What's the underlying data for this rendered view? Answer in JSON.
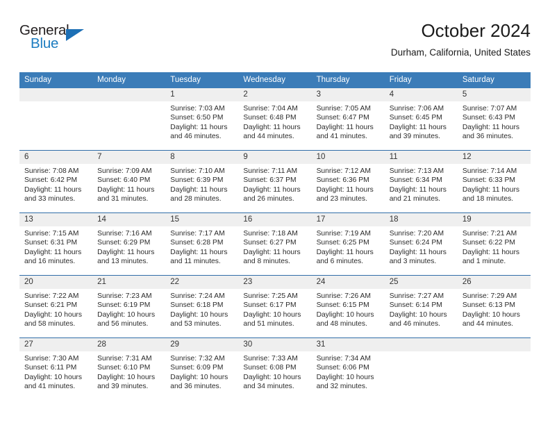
{
  "logo": {
    "line1": "General",
    "line2": "Blue",
    "triangle_icon": "triangle-icon",
    "color_dark": "#231f20",
    "color_blue": "#1c7cc0"
  },
  "header": {
    "title": "October 2024",
    "location": "Durham, California, United States"
  },
  "theme": {
    "header_blue": "#3b7cb8",
    "row_divider": "#2f6da8",
    "daynum_band": "#efefef"
  },
  "weekdays": [
    "Sunday",
    "Monday",
    "Tuesday",
    "Wednesday",
    "Thursday",
    "Friday",
    "Saturday"
  ],
  "weeks": [
    [
      {
        "day": "",
        "sunrise": "",
        "sunset": "",
        "daylight_1": "",
        "daylight_2": ""
      },
      {
        "day": "",
        "sunrise": "",
        "sunset": "",
        "daylight_1": "",
        "daylight_2": ""
      },
      {
        "day": "1",
        "sunrise": "Sunrise: 7:03 AM",
        "sunset": "Sunset: 6:50 PM",
        "daylight_1": "Daylight: 11 hours",
        "daylight_2": "and 46 minutes."
      },
      {
        "day": "2",
        "sunrise": "Sunrise: 7:04 AM",
        "sunset": "Sunset: 6:48 PM",
        "daylight_1": "Daylight: 11 hours",
        "daylight_2": "and 44 minutes."
      },
      {
        "day": "3",
        "sunrise": "Sunrise: 7:05 AM",
        "sunset": "Sunset: 6:47 PM",
        "daylight_1": "Daylight: 11 hours",
        "daylight_2": "and 41 minutes."
      },
      {
        "day": "4",
        "sunrise": "Sunrise: 7:06 AM",
        "sunset": "Sunset: 6:45 PM",
        "daylight_1": "Daylight: 11 hours",
        "daylight_2": "and 39 minutes."
      },
      {
        "day": "5",
        "sunrise": "Sunrise: 7:07 AM",
        "sunset": "Sunset: 6:43 PM",
        "daylight_1": "Daylight: 11 hours",
        "daylight_2": "and 36 minutes."
      }
    ],
    [
      {
        "day": "6",
        "sunrise": "Sunrise: 7:08 AM",
        "sunset": "Sunset: 6:42 PM",
        "daylight_1": "Daylight: 11 hours",
        "daylight_2": "and 33 minutes."
      },
      {
        "day": "7",
        "sunrise": "Sunrise: 7:09 AM",
        "sunset": "Sunset: 6:40 PM",
        "daylight_1": "Daylight: 11 hours",
        "daylight_2": "and 31 minutes."
      },
      {
        "day": "8",
        "sunrise": "Sunrise: 7:10 AM",
        "sunset": "Sunset: 6:39 PM",
        "daylight_1": "Daylight: 11 hours",
        "daylight_2": "and 28 minutes."
      },
      {
        "day": "9",
        "sunrise": "Sunrise: 7:11 AM",
        "sunset": "Sunset: 6:37 PM",
        "daylight_1": "Daylight: 11 hours",
        "daylight_2": "and 26 minutes."
      },
      {
        "day": "10",
        "sunrise": "Sunrise: 7:12 AM",
        "sunset": "Sunset: 6:36 PM",
        "daylight_1": "Daylight: 11 hours",
        "daylight_2": "and 23 minutes."
      },
      {
        "day": "11",
        "sunrise": "Sunrise: 7:13 AM",
        "sunset": "Sunset: 6:34 PM",
        "daylight_1": "Daylight: 11 hours",
        "daylight_2": "and 21 minutes."
      },
      {
        "day": "12",
        "sunrise": "Sunrise: 7:14 AM",
        "sunset": "Sunset: 6:33 PM",
        "daylight_1": "Daylight: 11 hours",
        "daylight_2": "and 18 minutes."
      }
    ],
    [
      {
        "day": "13",
        "sunrise": "Sunrise: 7:15 AM",
        "sunset": "Sunset: 6:31 PM",
        "daylight_1": "Daylight: 11 hours",
        "daylight_2": "and 16 minutes."
      },
      {
        "day": "14",
        "sunrise": "Sunrise: 7:16 AM",
        "sunset": "Sunset: 6:29 PM",
        "daylight_1": "Daylight: 11 hours",
        "daylight_2": "and 13 minutes."
      },
      {
        "day": "15",
        "sunrise": "Sunrise: 7:17 AM",
        "sunset": "Sunset: 6:28 PM",
        "daylight_1": "Daylight: 11 hours",
        "daylight_2": "and 11 minutes."
      },
      {
        "day": "16",
        "sunrise": "Sunrise: 7:18 AM",
        "sunset": "Sunset: 6:27 PM",
        "daylight_1": "Daylight: 11 hours",
        "daylight_2": "and 8 minutes."
      },
      {
        "day": "17",
        "sunrise": "Sunrise: 7:19 AM",
        "sunset": "Sunset: 6:25 PM",
        "daylight_1": "Daylight: 11 hours",
        "daylight_2": "and 6 minutes."
      },
      {
        "day": "18",
        "sunrise": "Sunrise: 7:20 AM",
        "sunset": "Sunset: 6:24 PM",
        "daylight_1": "Daylight: 11 hours",
        "daylight_2": "and 3 minutes."
      },
      {
        "day": "19",
        "sunrise": "Sunrise: 7:21 AM",
        "sunset": "Sunset: 6:22 PM",
        "daylight_1": "Daylight: 11 hours",
        "daylight_2": "and 1 minute."
      }
    ],
    [
      {
        "day": "20",
        "sunrise": "Sunrise: 7:22 AM",
        "sunset": "Sunset: 6:21 PM",
        "daylight_1": "Daylight: 10 hours",
        "daylight_2": "and 58 minutes."
      },
      {
        "day": "21",
        "sunrise": "Sunrise: 7:23 AM",
        "sunset": "Sunset: 6:19 PM",
        "daylight_1": "Daylight: 10 hours",
        "daylight_2": "and 56 minutes."
      },
      {
        "day": "22",
        "sunrise": "Sunrise: 7:24 AM",
        "sunset": "Sunset: 6:18 PM",
        "daylight_1": "Daylight: 10 hours",
        "daylight_2": "and 53 minutes."
      },
      {
        "day": "23",
        "sunrise": "Sunrise: 7:25 AM",
        "sunset": "Sunset: 6:17 PM",
        "daylight_1": "Daylight: 10 hours",
        "daylight_2": "and 51 minutes."
      },
      {
        "day": "24",
        "sunrise": "Sunrise: 7:26 AM",
        "sunset": "Sunset: 6:15 PM",
        "daylight_1": "Daylight: 10 hours",
        "daylight_2": "and 48 minutes."
      },
      {
        "day": "25",
        "sunrise": "Sunrise: 7:27 AM",
        "sunset": "Sunset: 6:14 PM",
        "daylight_1": "Daylight: 10 hours",
        "daylight_2": "and 46 minutes."
      },
      {
        "day": "26",
        "sunrise": "Sunrise: 7:29 AM",
        "sunset": "Sunset: 6:13 PM",
        "daylight_1": "Daylight: 10 hours",
        "daylight_2": "and 44 minutes."
      }
    ],
    [
      {
        "day": "27",
        "sunrise": "Sunrise: 7:30 AM",
        "sunset": "Sunset: 6:11 PM",
        "daylight_1": "Daylight: 10 hours",
        "daylight_2": "and 41 minutes."
      },
      {
        "day": "28",
        "sunrise": "Sunrise: 7:31 AM",
        "sunset": "Sunset: 6:10 PM",
        "daylight_1": "Daylight: 10 hours",
        "daylight_2": "and 39 minutes."
      },
      {
        "day": "29",
        "sunrise": "Sunrise: 7:32 AM",
        "sunset": "Sunset: 6:09 PM",
        "daylight_1": "Daylight: 10 hours",
        "daylight_2": "and 36 minutes."
      },
      {
        "day": "30",
        "sunrise": "Sunrise: 7:33 AM",
        "sunset": "Sunset: 6:08 PM",
        "daylight_1": "Daylight: 10 hours",
        "daylight_2": "and 34 minutes."
      },
      {
        "day": "31",
        "sunrise": "Sunrise: 7:34 AM",
        "sunset": "Sunset: 6:06 PM",
        "daylight_1": "Daylight: 10 hours",
        "daylight_2": "and 32 minutes."
      },
      {
        "day": "",
        "sunrise": "",
        "sunset": "",
        "daylight_1": "",
        "daylight_2": ""
      },
      {
        "day": "",
        "sunrise": "",
        "sunset": "",
        "daylight_1": "",
        "daylight_2": ""
      }
    ]
  ]
}
